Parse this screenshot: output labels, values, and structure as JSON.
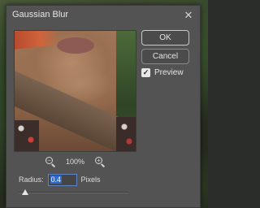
{
  "dialog": {
    "title": "Gaussian Blur",
    "close_glyph": "✕"
  },
  "buttons": {
    "ok_label": "OK",
    "cancel_label": "Cancel"
  },
  "preview_toggle": {
    "label": "Preview",
    "checked": true,
    "check_glyph": "✓"
  },
  "zoom": {
    "out_icon": "zoom-out-icon",
    "in_icon": "zoom-in-icon",
    "out_sign": "−",
    "in_sign": "+",
    "level": "100%"
  },
  "radius": {
    "label": "Radius:",
    "value": "0.4",
    "unit": "Pixels",
    "slider_fraction": 0.06
  },
  "colors": {
    "dialog_bg": "#535353",
    "selection": "#2f6ad0"
  }
}
